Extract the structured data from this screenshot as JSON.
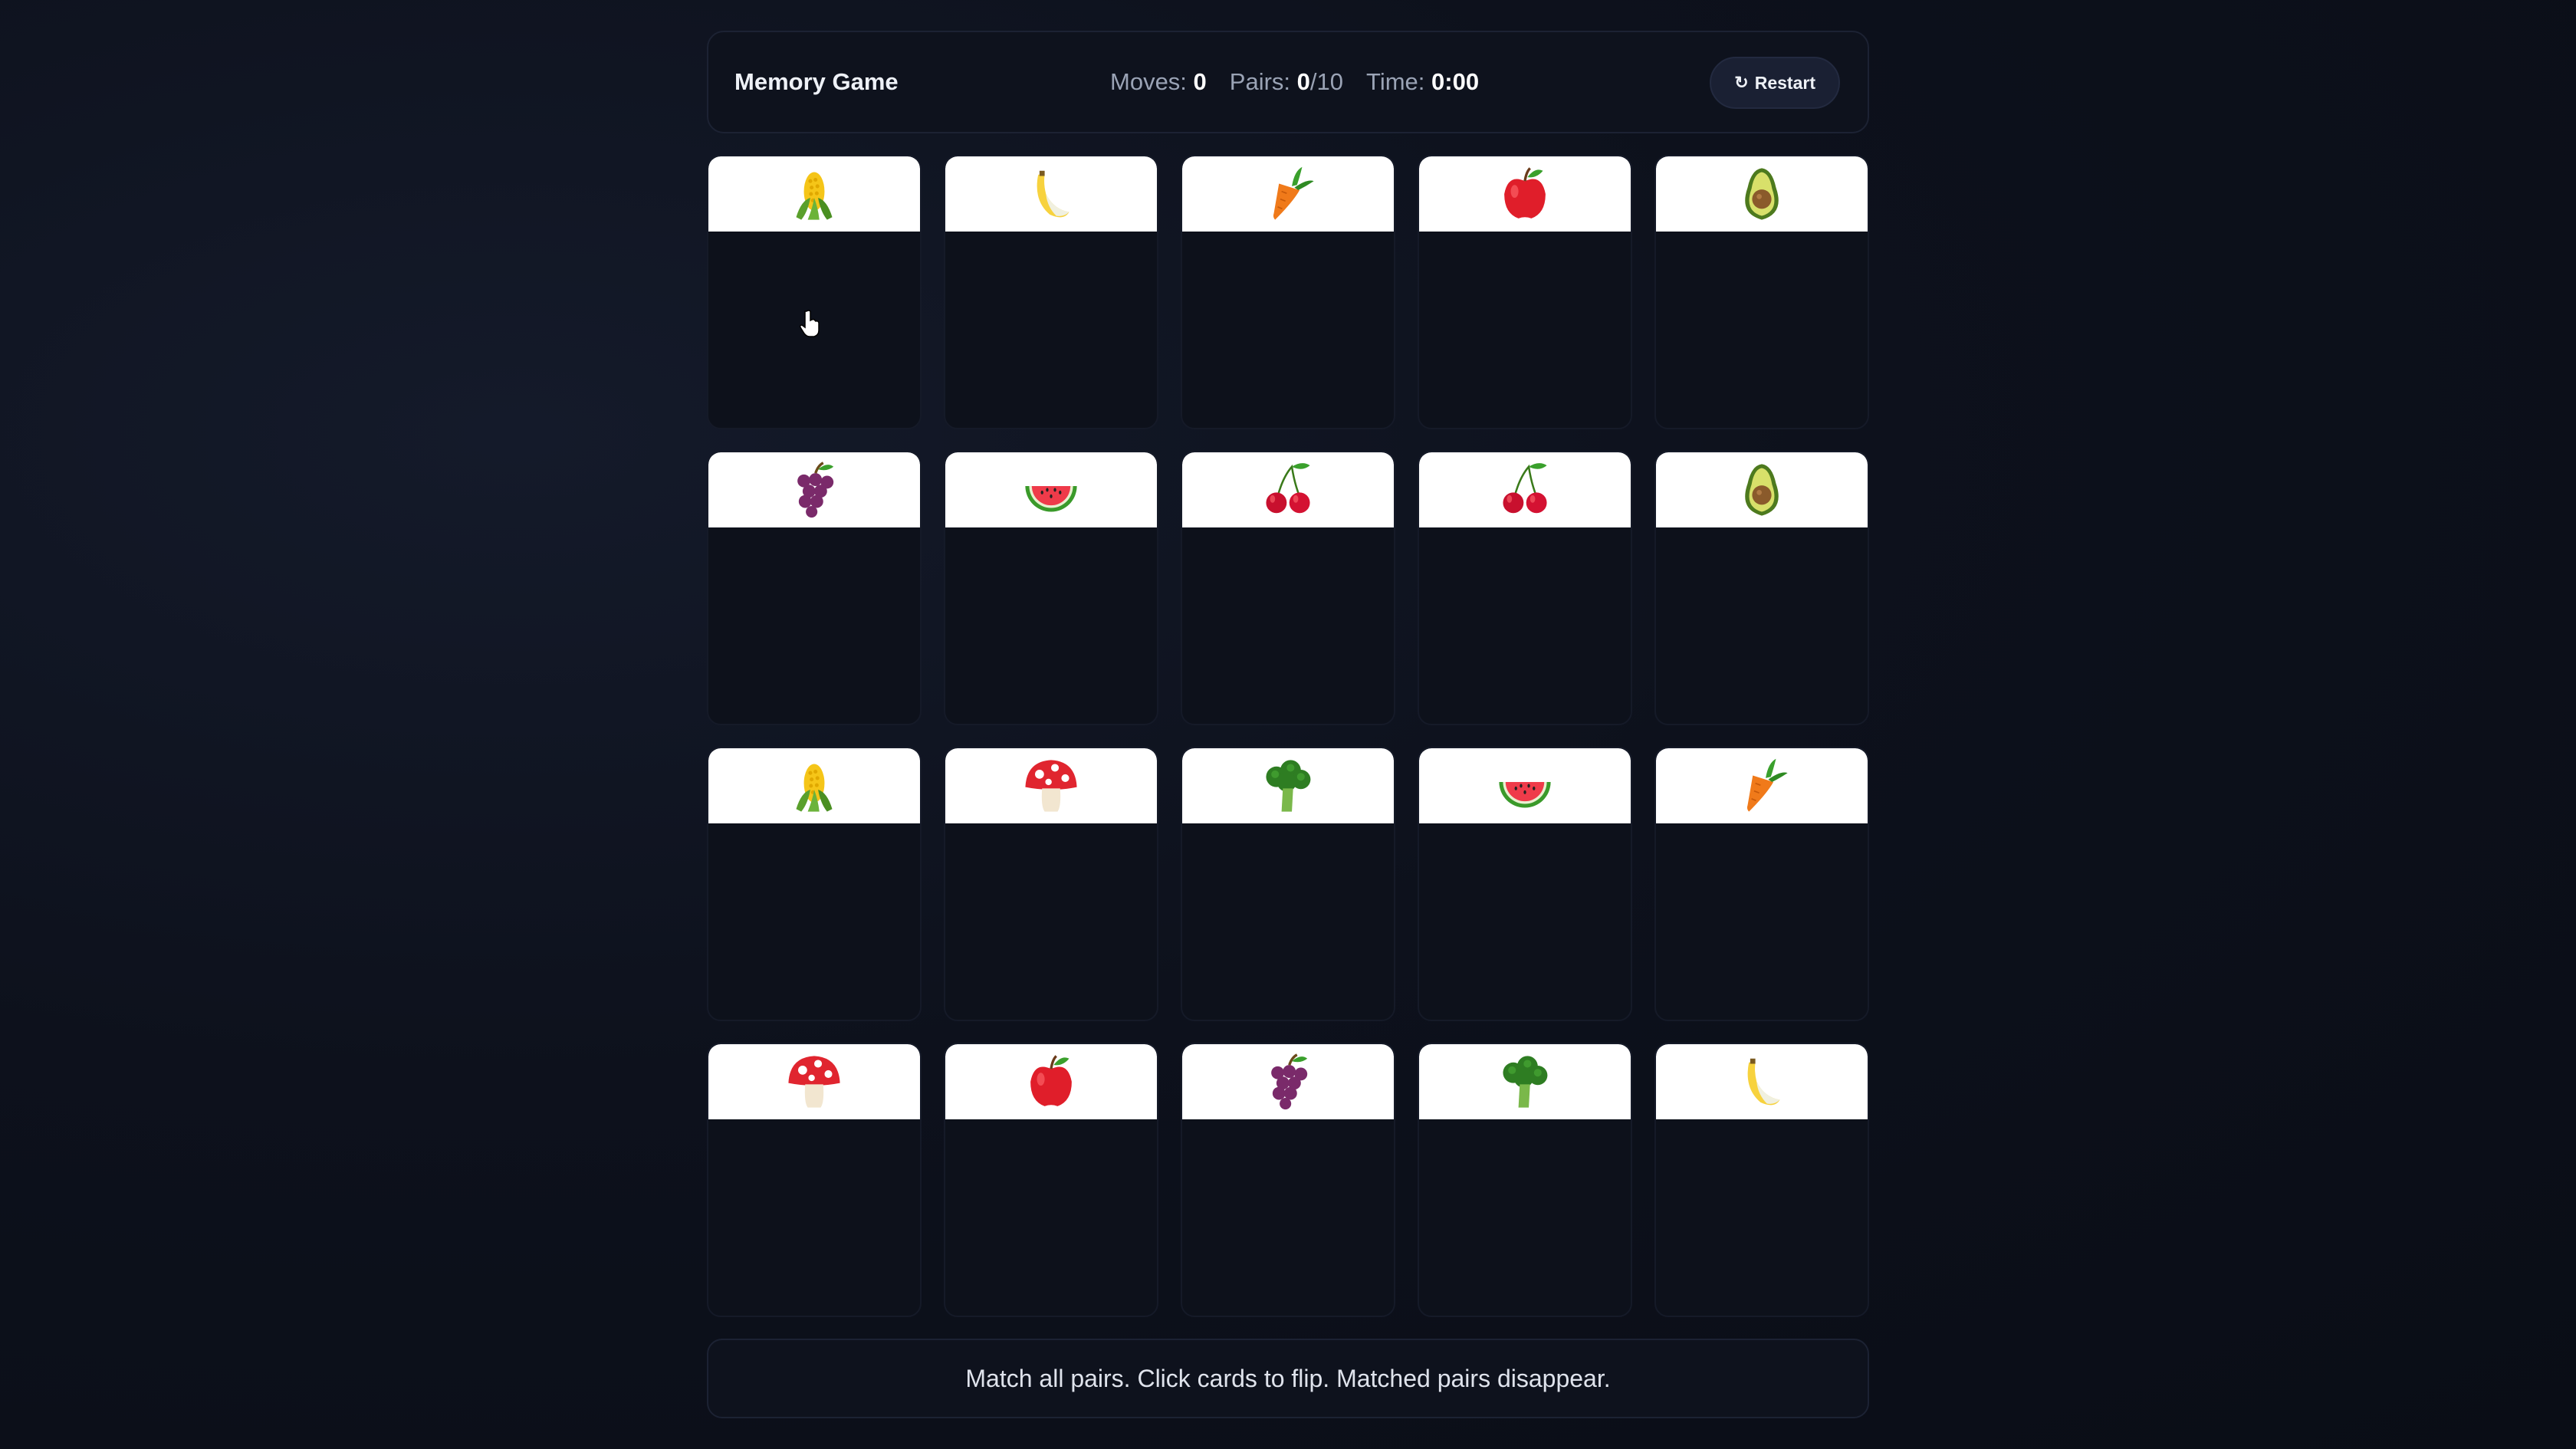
{
  "header": {
    "title": "Memory Game",
    "moves_label": "Moves:",
    "moves_value": "0",
    "pairs_label": "Pairs:",
    "pairs_value": "0",
    "pairs_total": "/10",
    "time_label": "Time:",
    "time_value": "0:00",
    "restart_label": "Restart",
    "restart_icon": "refresh-icon"
  },
  "cards": [
    {
      "icon": "corn"
    },
    {
      "icon": "banana"
    },
    {
      "icon": "carrot"
    },
    {
      "icon": "apple"
    },
    {
      "icon": "avocado"
    },
    {
      "icon": "grapes"
    },
    {
      "icon": "watermelon"
    },
    {
      "icon": "cherries"
    },
    {
      "icon": "cherries"
    },
    {
      "icon": "avocado"
    },
    {
      "icon": "corn"
    },
    {
      "icon": "mushroom"
    },
    {
      "icon": "broccoli"
    },
    {
      "icon": "watermelon"
    },
    {
      "icon": "carrot"
    },
    {
      "icon": "mushroom"
    },
    {
      "icon": "apple"
    },
    {
      "icon": "grapes"
    },
    {
      "icon": "broccoli"
    },
    {
      "icon": "banana"
    }
  ],
  "footer": {
    "instructions": "Match all pairs. Click cards to flip. Matched pairs disappear."
  },
  "colors": {
    "background": "#0d111c",
    "panel": "#0e121d",
    "card_back": "#0d111b",
    "card_face": "#ffffff"
  }
}
